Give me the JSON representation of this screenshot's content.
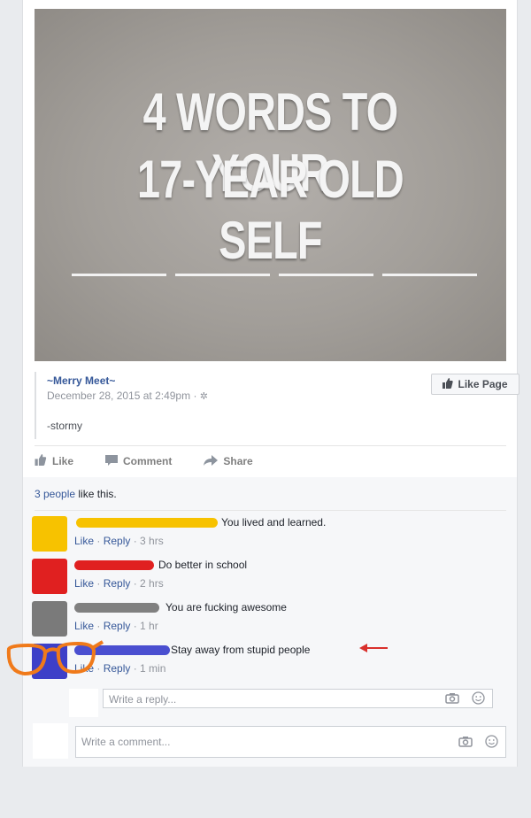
{
  "post": {
    "image_text": {
      "line1": "4 WORDS TO YOUR",
      "line2": "17-YEAR OLD SELF"
    },
    "page_name": "~Merry Meet~",
    "timestamp": "December 28, 2015 at 2:49pm",
    "body": "-stormy",
    "like_page_label": "Like Page"
  },
  "actions": {
    "like_label": "Like",
    "comment_label": "Comment",
    "share_label": "Share"
  },
  "likes_summary": {
    "count_text": "3 people",
    "rest_text": " like this."
  },
  "comments": [
    {
      "text": "You lived and learned.",
      "like": "Like",
      "reply": "Reply",
      "time": "3 hrs",
      "avatar_color": "#f7c200",
      "scribble_color": "#f7c200"
    },
    {
      "text": "Do better in school",
      "like": "Like",
      "reply": "Reply",
      "time": "2 hrs",
      "avatar_color": "#e02020",
      "scribble_color": "#e02020"
    },
    {
      "text": "You are fucking awesome",
      "like": "Like",
      "reply": "Reply",
      "time": "1 hr",
      "avatar_color": "#7a7a7a",
      "scribble_color": "#808080"
    },
    {
      "text": "Stay away from stupid people",
      "like": "Like",
      "reply": "Reply",
      "time": "1 min",
      "avatar_color": "#3d3fc8",
      "scribble_color": "#4a4fd0"
    }
  ],
  "reply_box": {
    "placeholder": "Write a reply..."
  },
  "comment_box": {
    "placeholder": "Write a comment..."
  },
  "colors": {
    "link": "#365899",
    "annotation_red": "#d9302c",
    "glasses_orange": "#f07a1a"
  },
  "icons": {
    "settings": "gear-icon",
    "like": "thumbs-up-icon",
    "comment": "speech-bubble-icon",
    "share": "share-arrow-icon",
    "camera": "camera-icon",
    "emoji": "smiley-icon"
  }
}
